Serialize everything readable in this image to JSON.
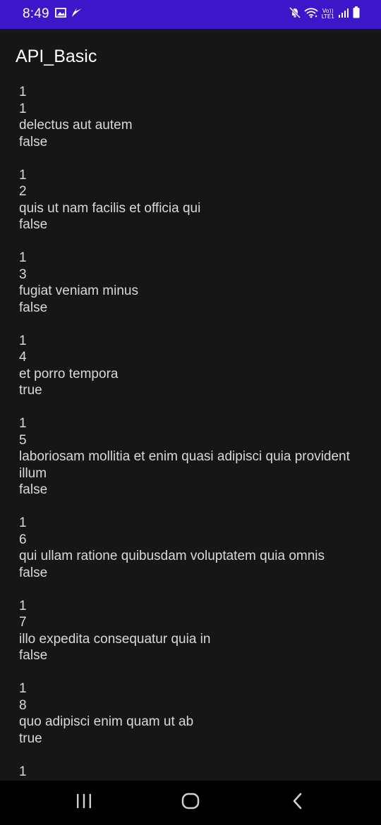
{
  "status_bar": {
    "time": "8:49",
    "left_icons": [
      "image-icon",
      "bird-icon"
    ],
    "right_icons": [
      "mute-icon",
      "wifi-icon",
      "volte-icon",
      "signal-icon",
      "battery-icon"
    ],
    "volte_top": "Vo))",
    "volte_bottom": "LTE1",
    "background": "#3b17c9"
  },
  "app_bar": {
    "title": "API_Basic"
  },
  "items": [
    {
      "userId": "1",
      "id": "1",
      "title": "delectus aut autem",
      "completed": "false"
    },
    {
      "userId": "1",
      "id": "2",
      "title": "quis ut nam facilis et officia qui",
      "completed": "false"
    },
    {
      "userId": "1",
      "id": "3",
      "title": "fugiat veniam minus",
      "completed": "false"
    },
    {
      "userId": "1",
      "id": "4",
      "title": "et porro tempora",
      "completed": "true"
    },
    {
      "userId": "1",
      "id": "5",
      "title": "laboriosam mollitia et enim quasi adipisci quia provident illum",
      "completed": "false"
    },
    {
      "userId": "1",
      "id": "6",
      "title": "qui ullam ratione quibusdam voluptatem quia omnis",
      "completed": "false"
    },
    {
      "userId": "1",
      "id": "7",
      "title": "illo expedita consequatur quia in",
      "completed": "false"
    },
    {
      "userId": "1",
      "id": "8",
      "title": "quo adipisci enim quam ut ab",
      "completed": "true"
    },
    {
      "userId": "1"
    }
  ],
  "nav_bar": {
    "buttons": [
      "recent-apps-icon",
      "home-icon",
      "back-icon"
    ]
  }
}
